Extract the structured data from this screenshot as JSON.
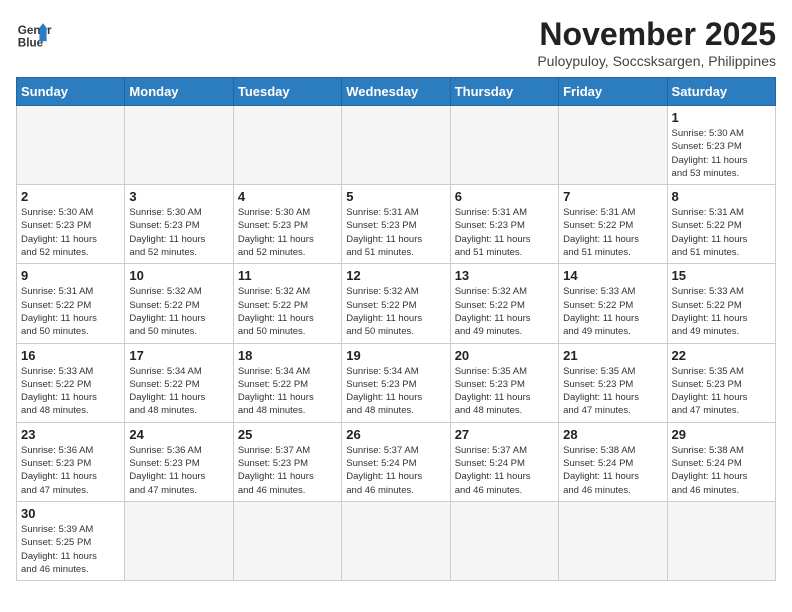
{
  "header": {
    "logo_line1": "General",
    "logo_line2": "Blue",
    "month_title": "November 2025",
    "location": "Puloypuloy, Soccsksargen, Philippines"
  },
  "weekdays": [
    "Sunday",
    "Monday",
    "Tuesday",
    "Wednesday",
    "Thursday",
    "Friday",
    "Saturday"
  ],
  "weeks": [
    [
      {
        "day": "",
        "info": ""
      },
      {
        "day": "",
        "info": ""
      },
      {
        "day": "",
        "info": ""
      },
      {
        "day": "",
        "info": ""
      },
      {
        "day": "",
        "info": ""
      },
      {
        "day": "",
        "info": ""
      },
      {
        "day": "1",
        "info": "Sunrise: 5:30 AM\nSunset: 5:23 PM\nDaylight: 11 hours\nand 53 minutes."
      }
    ],
    [
      {
        "day": "2",
        "info": "Sunrise: 5:30 AM\nSunset: 5:23 PM\nDaylight: 11 hours\nand 52 minutes."
      },
      {
        "day": "3",
        "info": "Sunrise: 5:30 AM\nSunset: 5:23 PM\nDaylight: 11 hours\nand 52 minutes."
      },
      {
        "day": "4",
        "info": "Sunrise: 5:30 AM\nSunset: 5:23 PM\nDaylight: 11 hours\nand 52 minutes."
      },
      {
        "day": "5",
        "info": "Sunrise: 5:31 AM\nSunset: 5:23 PM\nDaylight: 11 hours\nand 51 minutes."
      },
      {
        "day": "6",
        "info": "Sunrise: 5:31 AM\nSunset: 5:23 PM\nDaylight: 11 hours\nand 51 minutes."
      },
      {
        "day": "7",
        "info": "Sunrise: 5:31 AM\nSunset: 5:22 PM\nDaylight: 11 hours\nand 51 minutes."
      },
      {
        "day": "8",
        "info": "Sunrise: 5:31 AM\nSunset: 5:22 PM\nDaylight: 11 hours\nand 51 minutes."
      }
    ],
    [
      {
        "day": "9",
        "info": "Sunrise: 5:31 AM\nSunset: 5:22 PM\nDaylight: 11 hours\nand 50 minutes."
      },
      {
        "day": "10",
        "info": "Sunrise: 5:32 AM\nSunset: 5:22 PM\nDaylight: 11 hours\nand 50 minutes."
      },
      {
        "day": "11",
        "info": "Sunrise: 5:32 AM\nSunset: 5:22 PM\nDaylight: 11 hours\nand 50 minutes."
      },
      {
        "day": "12",
        "info": "Sunrise: 5:32 AM\nSunset: 5:22 PM\nDaylight: 11 hours\nand 50 minutes."
      },
      {
        "day": "13",
        "info": "Sunrise: 5:32 AM\nSunset: 5:22 PM\nDaylight: 11 hours\nand 49 minutes."
      },
      {
        "day": "14",
        "info": "Sunrise: 5:33 AM\nSunset: 5:22 PM\nDaylight: 11 hours\nand 49 minutes."
      },
      {
        "day": "15",
        "info": "Sunrise: 5:33 AM\nSunset: 5:22 PM\nDaylight: 11 hours\nand 49 minutes."
      }
    ],
    [
      {
        "day": "16",
        "info": "Sunrise: 5:33 AM\nSunset: 5:22 PM\nDaylight: 11 hours\nand 48 minutes."
      },
      {
        "day": "17",
        "info": "Sunrise: 5:34 AM\nSunset: 5:22 PM\nDaylight: 11 hours\nand 48 minutes."
      },
      {
        "day": "18",
        "info": "Sunrise: 5:34 AM\nSunset: 5:22 PM\nDaylight: 11 hours\nand 48 minutes."
      },
      {
        "day": "19",
        "info": "Sunrise: 5:34 AM\nSunset: 5:23 PM\nDaylight: 11 hours\nand 48 minutes."
      },
      {
        "day": "20",
        "info": "Sunrise: 5:35 AM\nSunset: 5:23 PM\nDaylight: 11 hours\nand 48 minutes."
      },
      {
        "day": "21",
        "info": "Sunrise: 5:35 AM\nSunset: 5:23 PM\nDaylight: 11 hours\nand 47 minutes."
      },
      {
        "day": "22",
        "info": "Sunrise: 5:35 AM\nSunset: 5:23 PM\nDaylight: 11 hours\nand 47 minutes."
      }
    ],
    [
      {
        "day": "23",
        "info": "Sunrise: 5:36 AM\nSunset: 5:23 PM\nDaylight: 11 hours\nand 47 minutes."
      },
      {
        "day": "24",
        "info": "Sunrise: 5:36 AM\nSunset: 5:23 PM\nDaylight: 11 hours\nand 47 minutes."
      },
      {
        "day": "25",
        "info": "Sunrise: 5:37 AM\nSunset: 5:23 PM\nDaylight: 11 hours\nand 46 minutes."
      },
      {
        "day": "26",
        "info": "Sunrise: 5:37 AM\nSunset: 5:24 PM\nDaylight: 11 hours\nand 46 minutes."
      },
      {
        "day": "27",
        "info": "Sunrise: 5:37 AM\nSunset: 5:24 PM\nDaylight: 11 hours\nand 46 minutes."
      },
      {
        "day": "28",
        "info": "Sunrise: 5:38 AM\nSunset: 5:24 PM\nDaylight: 11 hours\nand 46 minutes."
      },
      {
        "day": "29",
        "info": "Sunrise: 5:38 AM\nSunset: 5:24 PM\nDaylight: 11 hours\nand 46 minutes."
      }
    ],
    [
      {
        "day": "30",
        "info": "Sunrise: 5:39 AM\nSunset: 5:25 PM\nDaylight: 11 hours\nand 46 minutes."
      },
      {
        "day": "",
        "info": ""
      },
      {
        "day": "",
        "info": ""
      },
      {
        "day": "",
        "info": ""
      },
      {
        "day": "",
        "info": ""
      },
      {
        "day": "",
        "info": ""
      },
      {
        "day": "",
        "info": ""
      }
    ]
  ]
}
